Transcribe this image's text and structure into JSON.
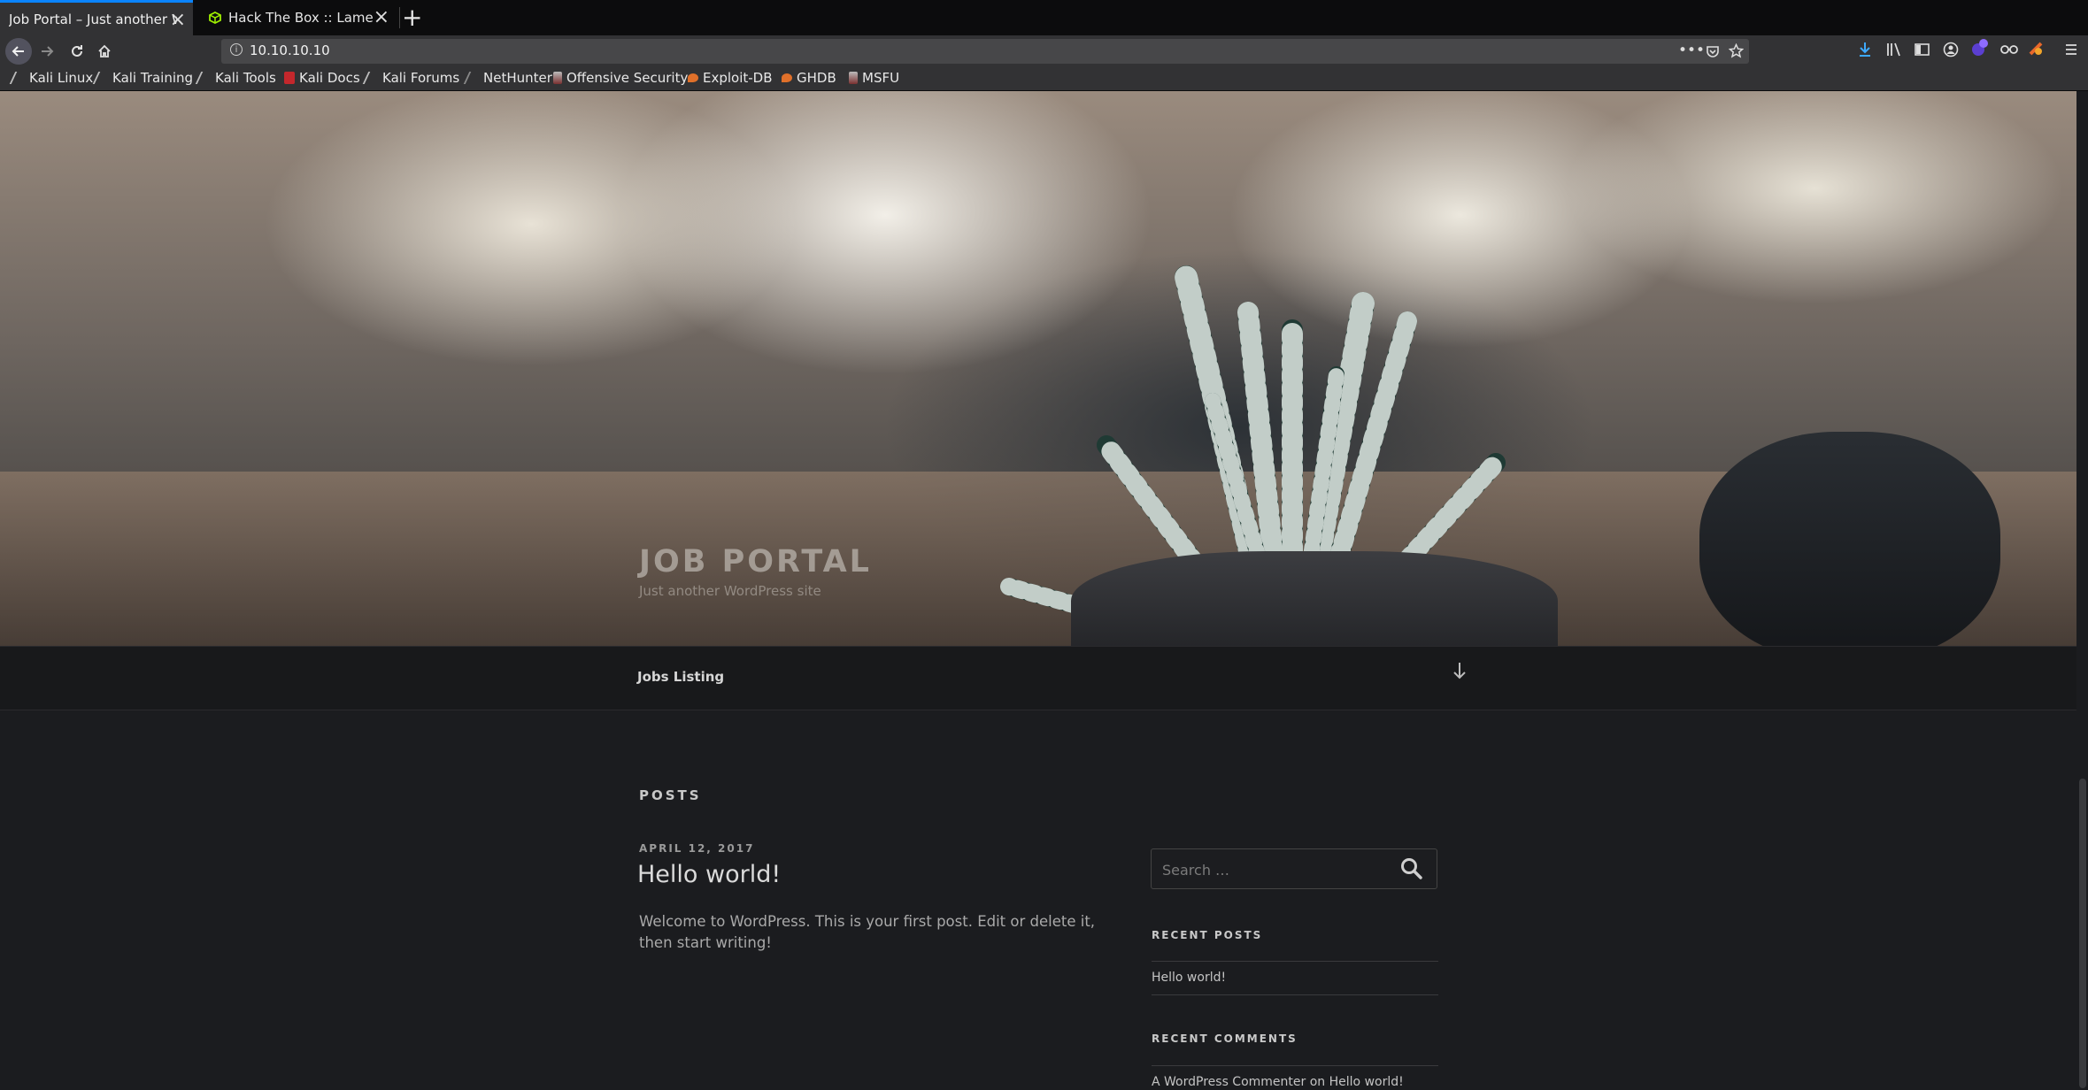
{
  "tabs": [
    {
      "title": "Job Portal – Just another Wo",
      "active": true,
      "close": "×"
    },
    {
      "title": "Hack The Box :: Lame",
      "active": false,
      "close": "×"
    }
  ],
  "new_tab_label": "+",
  "url": "10.10.10.10",
  "bookmarks": [
    {
      "label": "Kali Linux",
      "icon": "kali-icon"
    },
    {
      "label": "Kali Training",
      "icon": "kali-icon"
    },
    {
      "label": "Kali Tools",
      "icon": "kali-icon"
    },
    {
      "label": "Kali Docs",
      "icon": "kali-docs-icon"
    },
    {
      "label": "Kali Forums",
      "icon": "kali-icon"
    },
    {
      "label": "NetHunter",
      "icon": "kali-icon"
    },
    {
      "label": "Offensive Security",
      "icon": "offsec-icon"
    },
    {
      "label": "Exploit-DB",
      "icon": "exploitdb-icon"
    },
    {
      "label": "GHDB",
      "icon": "exploitdb-icon"
    },
    {
      "label": "MSFU",
      "icon": "offsec-icon"
    }
  ],
  "site": {
    "title": "JOB PORTAL",
    "description": "Just another WordPress site"
  },
  "menu": {
    "item": "Jobs Listing"
  },
  "posts": {
    "heading": "POSTS",
    "items": [
      {
        "date": "APRIL 12, 2017",
        "title": "Hello world!",
        "excerpt": "Welcome to WordPress. This is your first post. Edit or delete it, then start writing!"
      }
    ]
  },
  "sidebar": {
    "search_placeholder": "Search …",
    "recent_posts_title": "RECENT POSTS",
    "recent_posts": [
      "Hello world!"
    ],
    "recent_comments_title": "RECENT COMMENTS",
    "comment_author": "A WordPress Commenter",
    "comment_on": "on",
    "comment_post": "Hello world!"
  },
  "colors": {
    "accent": "#0a84ff",
    "chrome_bg": "#323234",
    "page_bg": "#1b1c1f"
  }
}
